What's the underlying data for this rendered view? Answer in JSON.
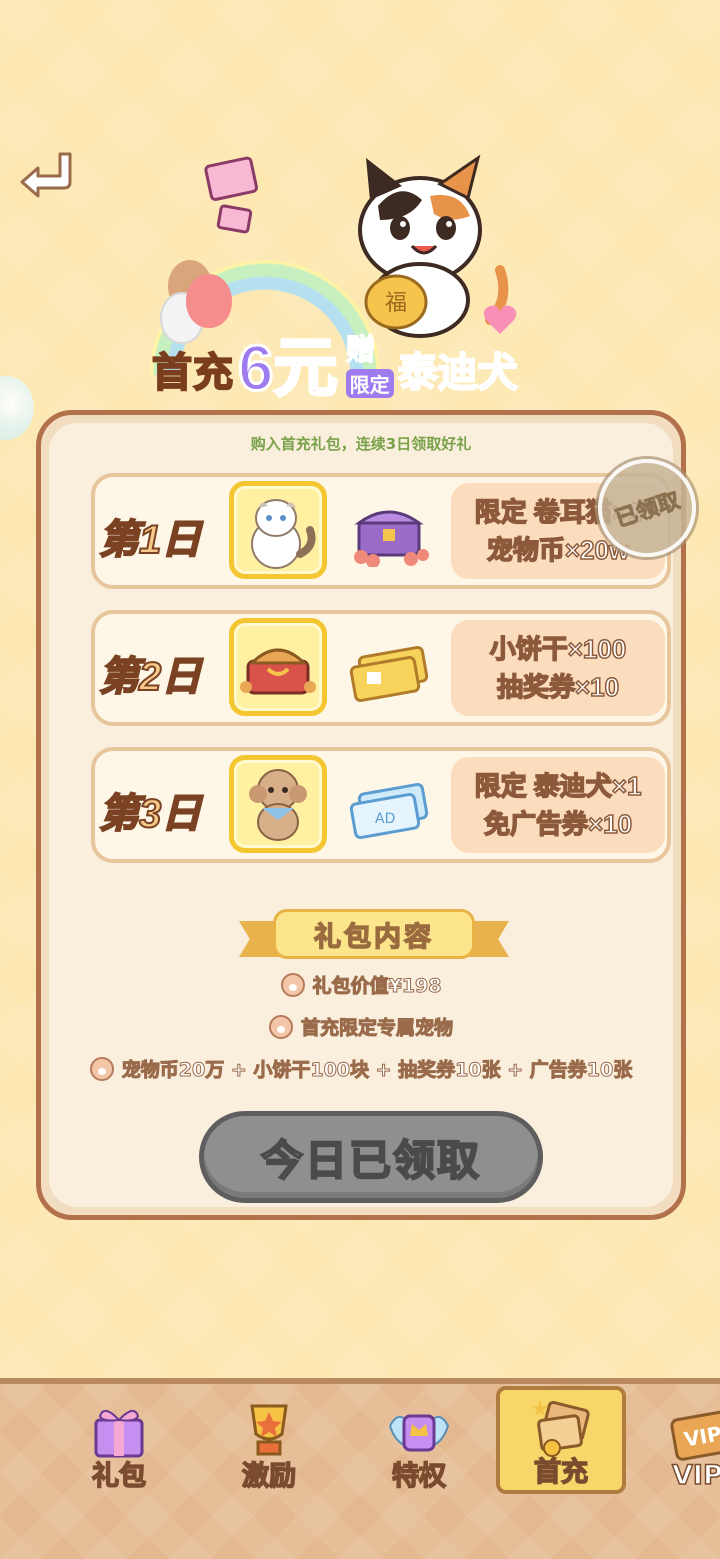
{
  "header": {
    "title_prefix": "首充",
    "title_amount": "6元",
    "title_gift": "赠",
    "title_limited": "限定",
    "title_pet": "泰迪犬",
    "subtitle": "购入首充礼包，连续3日领取好礼"
  },
  "days": [
    {
      "label": "第1日",
      "icon": "ragdoll-cat-icon",
      "item_icon": "treasure-chest-icon",
      "reward_line1": "限定 卷耳猫×1",
      "reward_line2": "宠物币×20w",
      "claimed": true,
      "stamp_text": "已领取"
    },
    {
      "label": "第2日",
      "icon": "biscuit-basket-icon",
      "item_icon": "gold-ticket-icon",
      "reward_line1": "小饼干×100",
      "reward_line2": "抽奖券×10",
      "claimed": false
    },
    {
      "label": "第3日",
      "icon": "teddy-dog-icon",
      "item_icon": "blue-ad-ticket-icon",
      "reward_line1": "限定 泰迪犬×1",
      "reward_line2": "免广告券×10",
      "claimed": false
    }
  ],
  "package": {
    "ribbon_title": "礼包内容",
    "lines": [
      "礼包价值¥198",
      "首充限定专属宠物",
      "宠物币20万 + 小饼干100块 + 抽奖券10张 + 广告券10张"
    ],
    "button_label": "今日已领取"
  },
  "side_tab_glyph": "»",
  "nav": {
    "items": [
      {
        "label": "礼包",
        "icon": "gift-box-icon",
        "active": false
      },
      {
        "label": "激励",
        "icon": "trophy-icon",
        "active": false
      },
      {
        "label": "特权",
        "icon": "crown-wings-icon",
        "active": false
      },
      {
        "label": "首充",
        "icon": "first-charge-icon",
        "active": true
      },
      {
        "label": "VIP",
        "icon": "vip-ticket-icon",
        "active": false
      }
    ]
  },
  "colors": {
    "background": "#fde8b1",
    "card_border": "#b2714a",
    "accent_purple": "#9e7cf0",
    "accent_orange": "#f6a847",
    "subtitle_green": "#7aa24a",
    "claimed_button": "#8f8f8f",
    "nav_active": "#f7d769"
  }
}
